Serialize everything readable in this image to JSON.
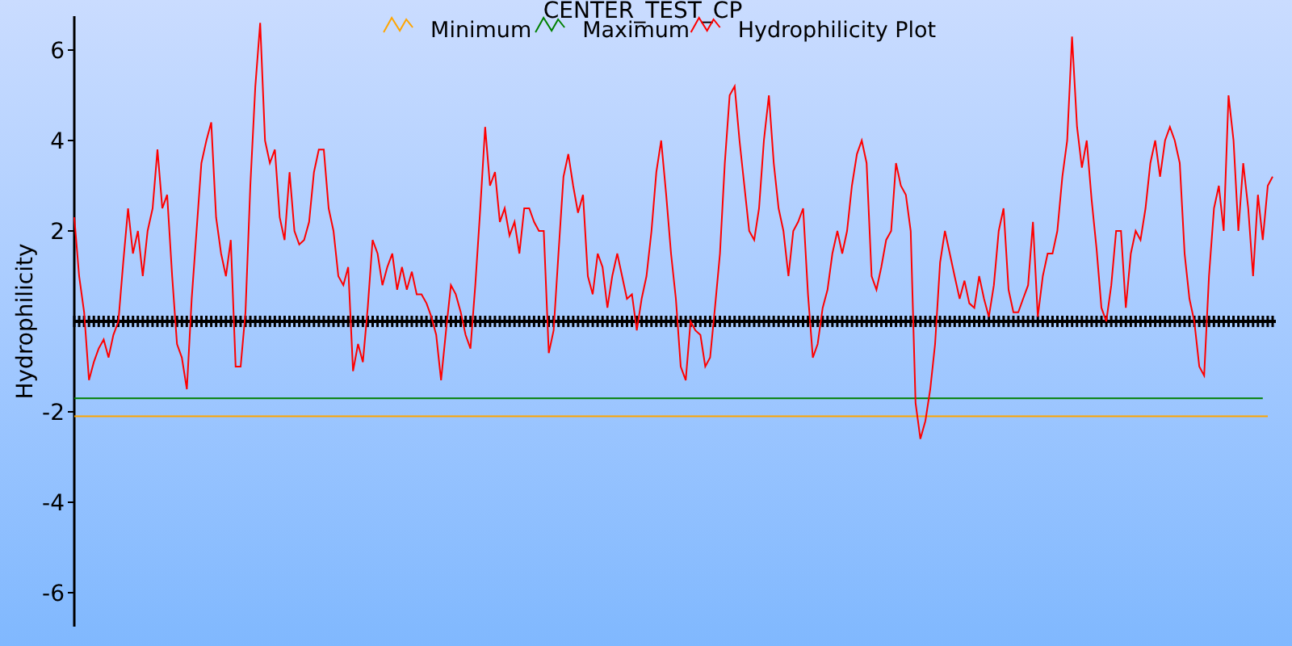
{
  "chart_data": {
    "type": "line",
    "title": "CENTER_TEST_CP",
    "ylabel": "Hydrophilicity",
    "ylim": [
      -6.75,
      6.75
    ],
    "yticks": [
      -6,
      -4,
      -2,
      2,
      4,
      6
    ],
    "legend": "top",
    "series": [
      {
        "name": "Minimum",
        "color": "#ffa500",
        "values": [
          -2.1,
          -2.1,
          -2.1,
          -2.1,
          -2.1,
          -2.1,
          -2.1,
          -2.1,
          -2.1,
          -2.1,
          -2.1,
          -2.1,
          -2.1,
          -2.1,
          -2.1,
          -2.1,
          -2.1,
          -2.1,
          -2.1,
          -2.1,
          -2.1,
          -2.1,
          -2.1,
          -2.1,
          -2.1,
          -2.1,
          -2.1,
          -2.1,
          -2.1,
          -2.1,
          -2.1,
          -2.1,
          -2.1,
          -2.1,
          -2.1,
          -2.1,
          -2.1,
          -2.1,
          -2.1,
          -2.1,
          -2.1,
          -2.1,
          -2.1,
          -2.1,
          -2.1,
          -2.1,
          -2.1,
          -2.1,
          -2.1,
          -2.1,
          -2.1,
          -2.1,
          -2.1,
          -2.1,
          -2.1,
          -2.1,
          -2.1,
          -2.1,
          -2.1,
          -2.1,
          -2.1,
          -2.1,
          -2.1,
          -2.1,
          -2.1,
          -2.1,
          -2.1,
          -2.1,
          -2.1,
          -2.1,
          -2.1,
          -2.1,
          -2.1,
          -2.1,
          -2.1,
          -2.1,
          -2.1,
          -2.1,
          -2.1,
          -2.1,
          -2.1,
          -2.1,
          -2.1,
          -2.1,
          -2.1,
          -2.1,
          -2.1,
          -2.1,
          -2.1,
          -2.1,
          -2.1,
          -2.1,
          -2.1,
          -2.1,
          -2.1,
          -2.1,
          -2.1,
          -2.1,
          -2.1,
          -2.1,
          -2.1,
          -2.1,
          -2.1,
          -2.1,
          -2.1,
          -2.1,
          -2.1,
          -2.1,
          -2.1,
          -2.1,
          -2.1,
          -2.1,
          -2.1,
          -2.1,
          -2.1,
          -2.1,
          -2.1,
          -2.1,
          -2.1,
          -2.1,
          -2.1,
          -2.1,
          -2.1,
          -2.1,
          -2.1,
          -2.1,
          -2.1,
          -2.1,
          -2.1,
          -2.1,
          -2.1,
          -2.1,
          -2.1,
          -2.1,
          -2.1,
          -2.1,
          -2.1,
          -2.1,
          -2.1,
          -2.1,
          -2.1,
          -2.1,
          -2.1,
          -2.1,
          -2.1,
          -2.1,
          -2.1,
          -2.1,
          -2.1,
          -2.1,
          -2.1,
          -2.1,
          -2.1,
          -2.1,
          -2.1,
          -2.1,
          -2.1,
          -2.1,
          -2.1,
          -2.1,
          -2.1,
          -2.1,
          -2.1,
          -2.1,
          -2.1,
          -2.1,
          -2.1,
          -2.1,
          -2.1,
          -2.1,
          -2.1,
          -2.1,
          -2.1,
          -2.1,
          -2.1,
          -2.1,
          -2.1,
          -2.1,
          -2.1,
          -2.1,
          -2.1,
          -2.1,
          -2.1,
          -2.1,
          -2.1,
          -2.1,
          -2.1,
          -2.1,
          -2.1,
          -2.1,
          -2.1,
          -2.1,
          -2.1,
          -2.1,
          -2.1,
          -2.1,
          -2.1,
          -2.1,
          -2.1,
          -2.1,
          -2.1,
          -2.1,
          -2.1,
          -2.1,
          -2.1,
          -2.1,
          -2.1,
          -2.1,
          -2.1,
          -2.1,
          -2.1,
          -2.1,
          -2.1,
          -2.1,
          -2.1,
          -2.1,
          -2.1,
          -2.1,
          -2.1,
          -2.1,
          -2.1,
          -2.1,
          -2.1,
          -2.1,
          -2.1,
          -2.1,
          -2.1,
          -2.1,
          -2.1,
          -2.1,
          -2.1,
          -2.1,
          -2.1,
          -2.1,
          -2.1,
          -2.1,
          -2.1,
          -2.1,
          -2.1,
          -2.1,
          -2.1,
          -2.1,
          -2.1,
          -2.1,
          -2.1
        ]
      },
      {
        "name": "Maximum",
        "color": "#008000",
        "values": [
          -1.7,
          -1.7,
          -1.7,
          -1.7,
          -1.7,
          -1.7,
          -1.7,
          -1.7,
          -1.7,
          -1.7,
          -1.7,
          -1.7,
          -1.7,
          -1.7,
          -1.7,
          -1.7,
          -1.7,
          -1.7,
          -1.7,
          -1.7,
          -1.7,
          -1.7,
          -1.7,
          -1.7,
          -1.7,
          -1.7,
          -1.7,
          -1.7,
          -1.7,
          -1.7,
          -1.7,
          -1.7,
          -1.7,
          -1.7,
          -1.7,
          -1.7,
          -1.7,
          -1.7,
          -1.7,
          -1.7,
          -1.7,
          -1.7,
          -1.7,
          -1.7,
          -1.7,
          -1.7,
          -1.7,
          -1.7,
          -1.7,
          -1.7,
          -1.7,
          -1.7,
          -1.7,
          -1.7,
          -1.7,
          -1.7,
          -1.7,
          -1.7,
          -1.7,
          -1.7,
          -1.7,
          -1.7,
          -1.7,
          -1.7,
          -1.7,
          -1.7,
          -1.7,
          -1.7,
          -1.7,
          -1.7,
          -1.7,
          -1.7,
          -1.7,
          -1.7,
          -1.7,
          -1.7,
          -1.7,
          -1.7,
          -1.7,
          -1.7,
          -1.7,
          -1.7,
          -1.7,
          -1.7,
          -1.7,
          -1.7,
          -1.7,
          -1.7,
          -1.7,
          -1.7,
          -1.7,
          -1.7,
          -1.7,
          -1.7,
          -1.7,
          -1.7,
          -1.7,
          -1.7,
          -1.7,
          -1.7,
          -1.7,
          -1.7,
          -1.7,
          -1.7,
          -1.7,
          -1.7,
          -1.7,
          -1.7,
          -1.7,
          -1.7,
          -1.7,
          -1.7,
          -1.7,
          -1.7,
          -1.7,
          -1.7,
          -1.7,
          -1.7,
          -1.7,
          -1.7,
          -1.7,
          -1.7,
          -1.7,
          -1.7,
          -1.7,
          -1.7,
          -1.7,
          -1.7,
          -1.7,
          -1.7,
          -1.7,
          -1.7,
          -1.7,
          -1.7,
          -1.7,
          -1.7,
          -1.7,
          -1.7,
          -1.7,
          -1.7,
          -1.7,
          -1.7,
          -1.7,
          -1.7,
          -1.7,
          -1.7,
          -1.7,
          -1.7,
          -1.7,
          -1.7,
          -1.7,
          -1.7,
          -1.7,
          -1.7,
          -1.7,
          -1.7,
          -1.7,
          -1.7,
          -1.7,
          -1.7,
          -1.7,
          -1.7,
          -1.7,
          -1.7,
          -1.7,
          -1.7,
          -1.7,
          -1.7,
          -1.7,
          -1.7,
          -1.7,
          -1.7,
          -1.7,
          -1.7,
          -1.7,
          -1.7,
          -1.7,
          -1.7,
          -1.7,
          -1.7,
          -1.7,
          -1.7,
          -1.7,
          -1.7,
          -1.7,
          -1.7,
          -1.7,
          -1.7,
          -1.7,
          -1.7,
          -1.7,
          -1.7,
          -1.7,
          -1.7,
          -1.7,
          -1.7,
          -1.7,
          -1.7,
          -1.7,
          -1.7,
          -1.7,
          -1.7,
          -1.7,
          -1.7,
          -1.7,
          -1.7,
          -1.7,
          -1.7,
          -1.7,
          -1.7,
          -1.7,
          -1.7,
          -1.7,
          -1.7,
          -1.7,
          -1.7,
          -1.7,
          -1.7,
          -1.7,
          -1.7,
          -1.7,
          -1.7,
          -1.7,
          -1.7,
          -1.7,
          -1.7,
          -1.7,
          -1.7,
          -1.7,
          -1.7,
          -1.7,
          -1.7,
          -1.7,
          -1.7,
          -1.7,
          -1.7,
          -1.7,
          -1.7,
          -1.7,
          -1.7,
          -1.7,
          -1.7,
          -1.7,
          -1.7
        ]
      },
      {
        "name": "Hydrophilicity Plot",
        "color": "#ff0000",
        "values": [
          2.3,
          1.0,
          0.2,
          -1.3,
          -0.9,
          -0.6,
          -0.4,
          -0.8,
          -0.3,
          0.0,
          1.3,
          2.5,
          1.5,
          2.0,
          1.0,
          2.0,
          2.5,
          3.8,
          2.5,
          2.8,
          1.0,
          -0.5,
          -0.8,
          -1.5,
          0.5,
          2.0,
          3.5,
          4.0,
          4.4,
          2.3,
          1.5,
          1.0,
          1.8,
          -1.0,
          -1.0,
          0.2,
          3.0,
          5.2,
          6.6,
          4.0,
          3.5,
          3.8,
          2.3,
          1.8,
          3.3,
          2.0,
          1.7,
          1.8,
          2.2,
          3.3,
          3.8,
          3.8,
          2.5,
          2.0,
          1.0,
          0.8,
          1.2,
          -1.1,
          -0.5,
          -0.9,
          0.3,
          1.8,
          1.5,
          0.8,
          1.2,
          1.5,
          0.7,
          1.2,
          0.7,
          1.1,
          0.6,
          0.6,
          0.4,
          0.1,
          -0.3,
          -1.3,
          -0.2,
          0.8,
          0.6,
          0.2,
          -0.3,
          -0.6,
          0.8,
          2.5,
          4.3,
          3.0,
          3.3,
          2.2,
          2.5,
          1.9,
          2.2,
          1.5,
          2.5,
          2.5,
          2.2,
          2.0,
          2.0,
          -0.7,
          -0.2,
          1.5,
          3.2,
          3.7,
          3.0,
          2.4,
          2.8,
          1.0,
          0.6,
          1.5,
          1.2,
          0.3,
          1.0,
          1.5,
          1.0,
          0.5,
          0.6,
          -0.2,
          0.5,
          1.0,
          2.0,
          3.3,
          4.0,
          2.8,
          1.5,
          0.5,
          -1.0,
          -1.3,
          0.0,
          -0.2,
          -0.3,
          -1.0,
          -0.8,
          0.3,
          1.5,
          3.5,
          5.0,
          5.2,
          4.0,
          3.0,
          2.0,
          1.8,
          2.5,
          4.0,
          5.0,
          3.5,
          2.5,
          2.0,
          1.0,
          2.0,
          2.2,
          2.5,
          0.6,
          -0.8,
          -0.5,
          0.3,
          0.7,
          1.5,
          2.0,
          1.5,
          2.0,
          3.0,
          3.7,
          4.0,
          3.5,
          1.0,
          0.7,
          1.2,
          1.8,
          2.0,
          3.5,
          3.0,
          2.8,
          2.0,
          -1.8,
          -2.6,
          -2.2,
          -1.5,
          -0.5,
          1.3,
          2.0,
          1.5,
          1.0,
          0.5,
          0.9,
          0.4,
          0.3,
          1.0,
          0.5,
          0.1,
          0.8,
          2.0,
          2.5,
          0.7,
          0.2,
          0.2,
          0.5,
          0.8,
          2.2,
          0.1,
          1.0,
          1.5,
          1.5,
          2.0,
          3.2,
          4.0,
          6.3,
          4.3,
          3.4,
          4.0,
          2.7,
          1.6,
          0.3,
          0.0,
          0.8,
          2.0,
          2.0,
          0.3,
          1.5,
          2.0,
          1.8,
          2.5,
          3.5,
          4.0,
          3.2,
          4.0,
          4.3,
          4.0,
          3.5,
          1.5,
          0.5,
          0.0,
          -1.0,
          -1.2,
          1.0,
          2.5,
          3.0,
          2.0,
          5.0,
          4.0,
          2.0,
          3.5,
          2.5,
          1.0,
          2.8,
          1.8,
          3.0,
          3.2
        ]
      }
    ]
  }
}
